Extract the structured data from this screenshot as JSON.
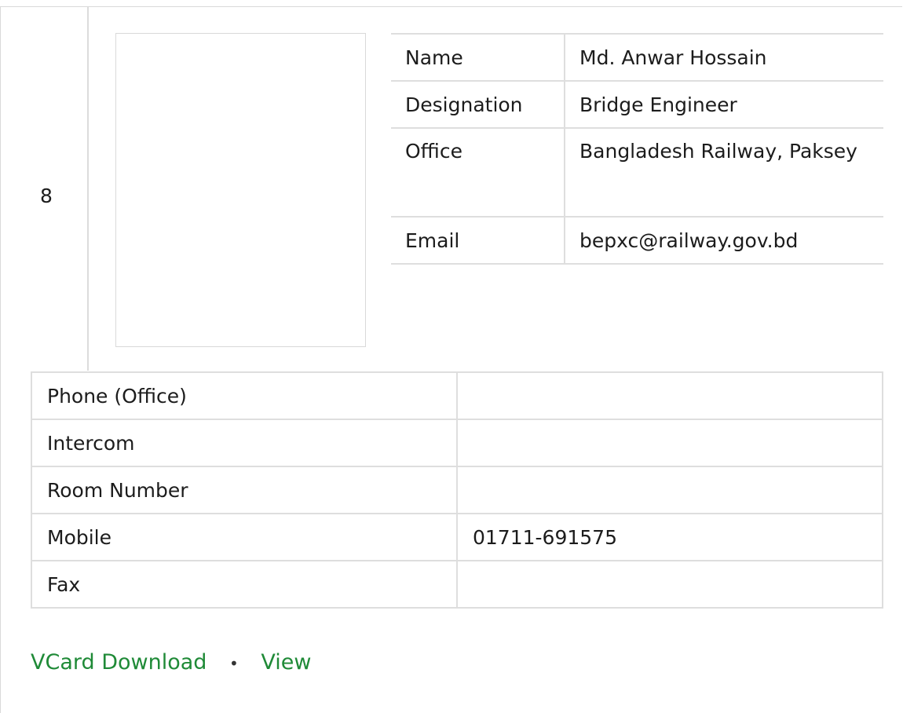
{
  "card": {
    "serial": "8",
    "info": [
      {
        "label": "Name",
        "value": "Md. Anwar Hossain"
      },
      {
        "label": "Designation",
        "value": "Bridge Engineer"
      },
      {
        "label": "Office",
        "value": "Bangladesh Railway, Paksey"
      },
      {
        "label": "Email",
        "value": "bepxc@railway.gov.bd"
      }
    ],
    "contacts": [
      {
        "label": "Phone (Office)",
        "value": ""
      },
      {
        "label": "Intercom",
        "value": ""
      },
      {
        "label": "Room Number",
        "value": ""
      },
      {
        "label": "Mobile",
        "value": "01711-691575"
      },
      {
        "label": "Fax",
        "value": ""
      }
    ],
    "links": {
      "vcard": "VCard Download",
      "separator": "•",
      "view": "View"
    }
  }
}
